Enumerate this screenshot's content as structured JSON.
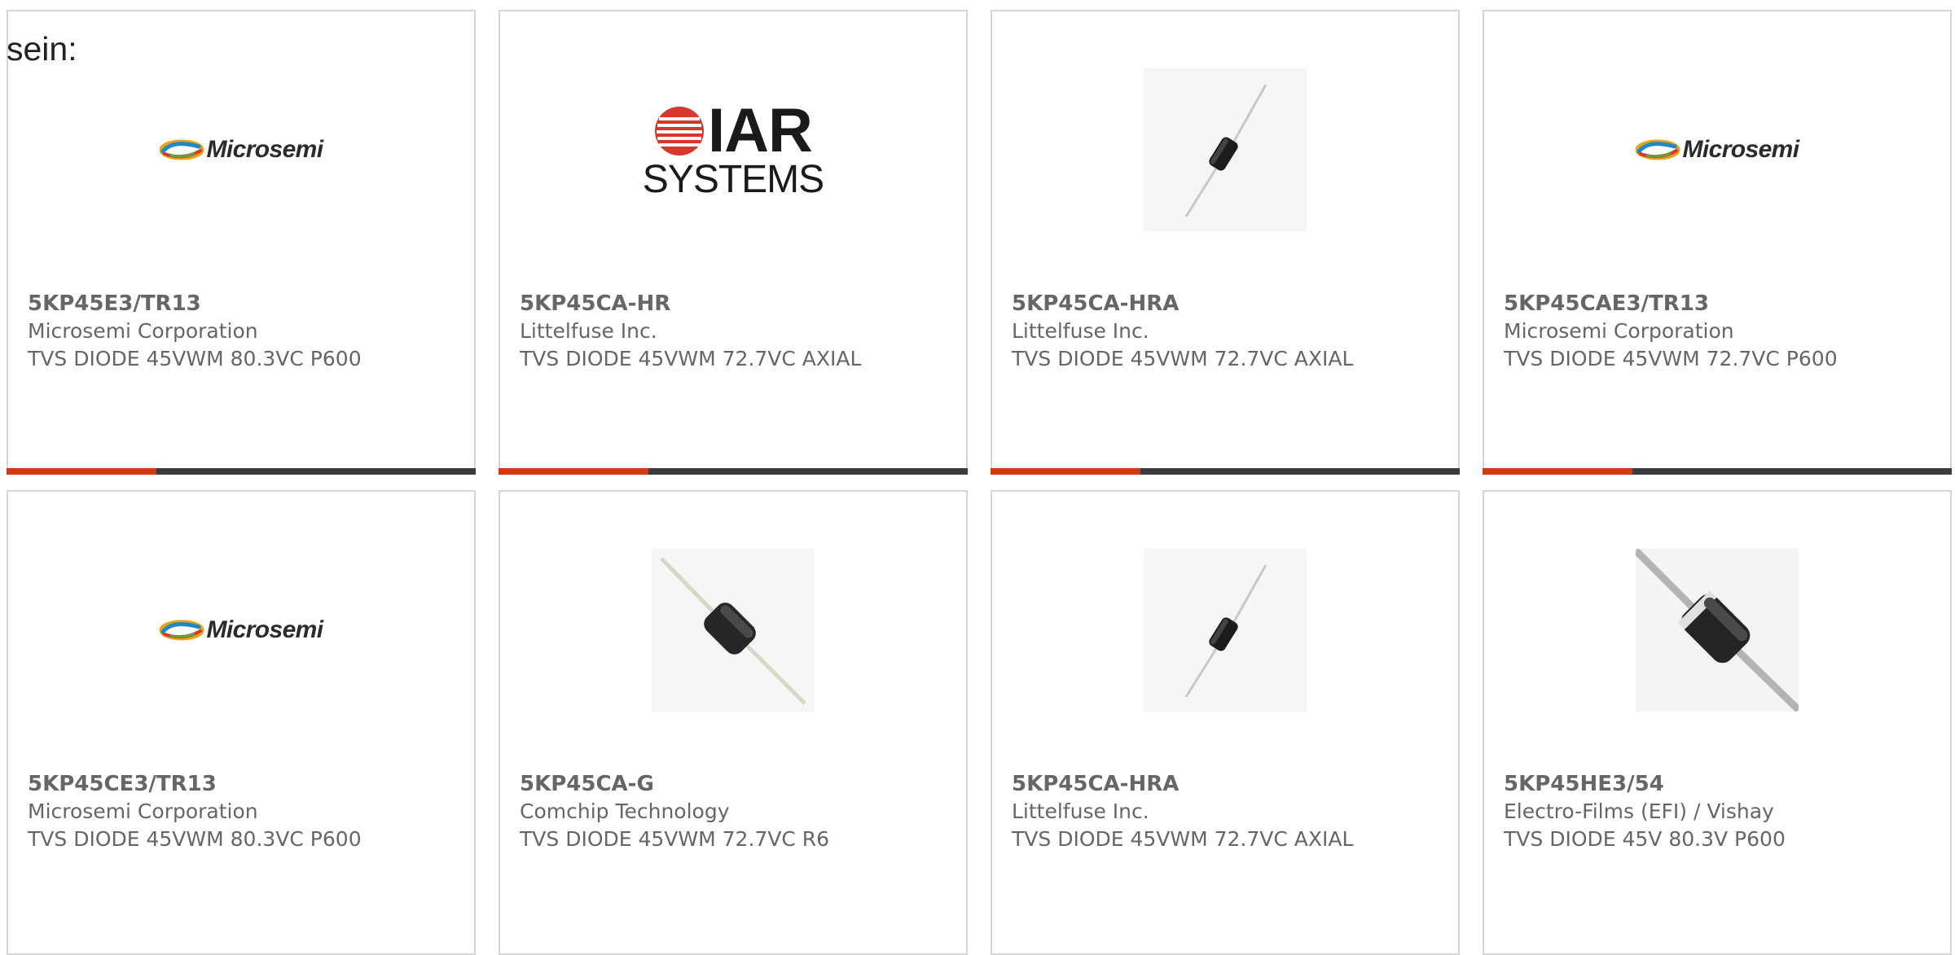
{
  "intro_text": "sein:",
  "colors": {
    "accent": "#d8380c",
    "bar": "#3a3d40",
    "card_border": "#d6d6d6",
    "text_gray": "#666666"
  },
  "cards": [
    {
      "part_number": "5KP45E3/TR13",
      "manufacturer": "Microsemi Corporation",
      "description": "TVS DIODE 45VWM 80.3VC P600",
      "image": "microsemi-logo",
      "logo_text": "Microsemi"
    },
    {
      "part_number": "5KP45CA-HR",
      "manufacturer": "Littelfuse Inc.",
      "description": "TVS DIODE 45VWM 72.7VC AXIAL",
      "image": "iar-systems-logo",
      "logo_text": "IAR",
      "logo_subtext": "SYSTEMS"
    },
    {
      "part_number": "5KP45CA-HRA",
      "manufacturer": "Littelfuse Inc.",
      "description": "TVS DIODE 45VWM 72.7VC AXIAL",
      "image": "axial-diode-photo"
    },
    {
      "part_number": "5KP45CAE3/TR13",
      "manufacturer": "Microsemi Corporation",
      "description": "TVS DIODE 45VWM 72.7VC P600",
      "image": "microsemi-logo",
      "logo_text": "Microsemi"
    },
    {
      "part_number": "5KP45CE3/TR13",
      "manufacturer": "Microsemi Corporation",
      "description": "TVS DIODE 45VWM 80.3VC P600",
      "image": "microsemi-logo",
      "logo_text": "Microsemi"
    },
    {
      "part_number": "5KP45CA-G",
      "manufacturer": "Comchip Technology",
      "description": "TVS DIODE 45VWM 72.7VC R6",
      "image": "axial-diode-photo"
    },
    {
      "part_number": "5KP45CA-HRA",
      "manufacturer": "Littelfuse Inc.",
      "description": "TVS DIODE 45VWM 72.7VC AXIAL",
      "image": "axial-diode-photo"
    },
    {
      "part_number": "5KP45HE3/54",
      "manufacturer": "Electro-Films (EFI) / Vishay",
      "description": "TVS DIODE 45V 80.3V P600",
      "image": "axial-diode-photo"
    }
  ]
}
